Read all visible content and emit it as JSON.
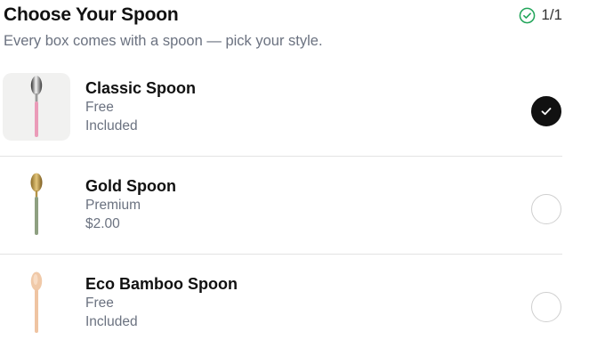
{
  "header": {
    "title": "Choose Your Spoon",
    "progress": "1/1",
    "subtitle": "Every box comes with a spoon — pick your style."
  },
  "colors": {
    "accent_check": "#22a55a",
    "selected_fill": "#111111"
  },
  "options": [
    {
      "name": "Classic Spoon",
      "tier": "Free",
      "price": "Included",
      "selected": true,
      "icon": "classic-spoon-icon"
    },
    {
      "name": "Gold Spoon",
      "tier": "Premium",
      "price": "$2.00",
      "selected": false,
      "icon": "gold-spoon-icon"
    },
    {
      "name": "Eco Bamboo Spoon",
      "tier": "Free",
      "price": "Included",
      "selected": false,
      "icon": "bamboo-spoon-icon"
    }
  ]
}
